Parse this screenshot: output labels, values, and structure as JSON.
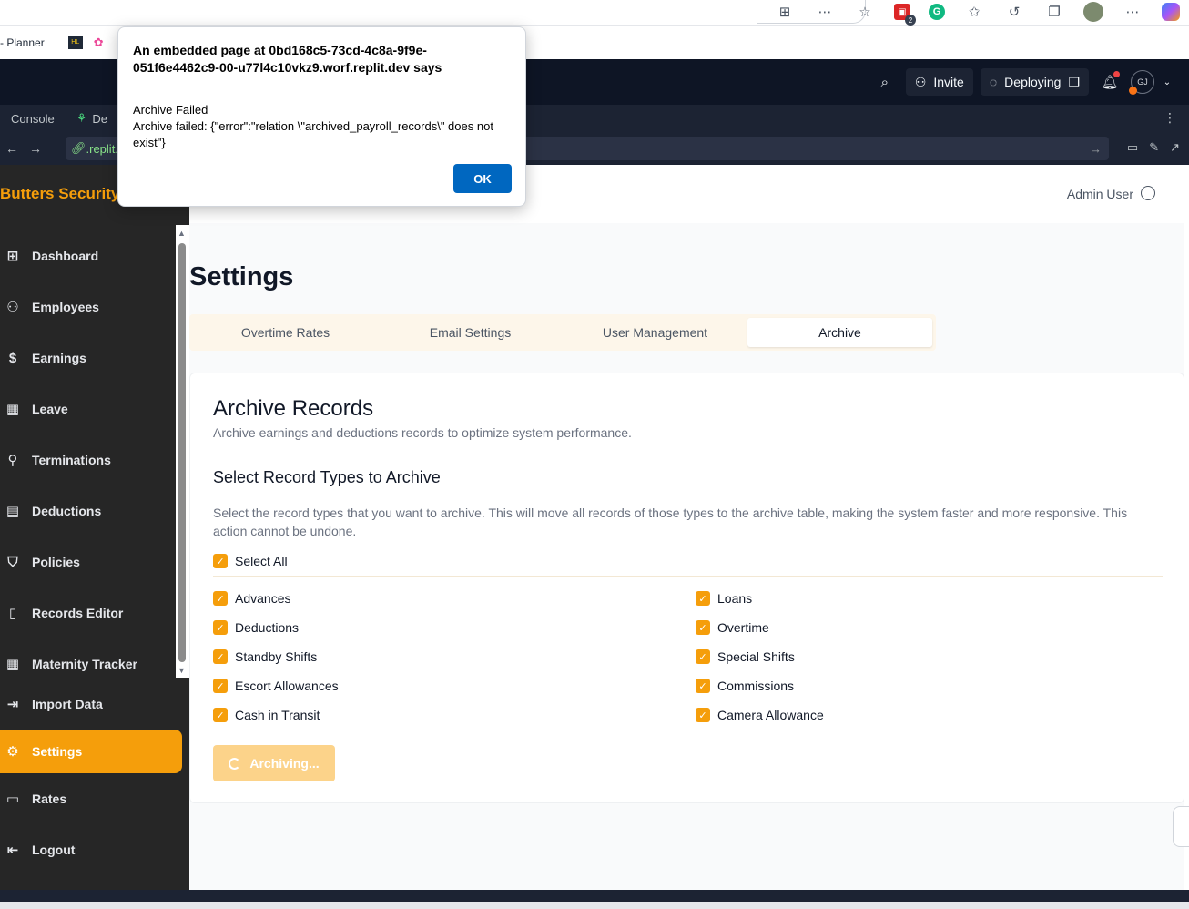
{
  "browser": {
    "bookmarks": [
      {
        "label": "- Planner"
      }
    ],
    "ext_badge": "2"
  },
  "replit": {
    "invite_label": "Invite",
    "deploying_label": "Deploying",
    "avatar_initials": "GJ",
    "tabs": [
      "Console",
      "De"
    ],
    "url_text": ".replit."
  },
  "dialog": {
    "title": "An embedded page at 0bd168c5-73cd-4c8a-9f9e-051f6e4462c9-00-u77l4c10vkz9.worf.replit.dev says",
    "line1": "Archive Failed",
    "line2": "Archive failed: {\"error\":\"relation \\\"archived_payroll_records\\\" does not exist\"}",
    "ok_label": "OK"
  },
  "app": {
    "brand": "Butters Security",
    "admin_user": "Admin User",
    "nav": [
      {
        "label": "Dashboard",
        "icon": "grid-icon"
      },
      {
        "label": "Employees",
        "icon": "users-icon"
      },
      {
        "label": "Earnings",
        "icon": "dollar-icon"
      },
      {
        "label": "Leave",
        "icon": "calendar-icon"
      },
      {
        "label": "Terminations",
        "icon": "user-minus-icon"
      },
      {
        "label": "Deductions",
        "icon": "wallet-icon"
      },
      {
        "label": "Policies",
        "icon": "shield-icon"
      },
      {
        "label": "Records Editor",
        "icon": "file-icon"
      },
      {
        "label": "Maternity Tracker",
        "icon": "calendar-icon"
      },
      {
        "label": "Import Data",
        "icon": "import-icon"
      },
      {
        "label": "Settings",
        "icon": "gear-icon",
        "active": true
      },
      {
        "label": "Rates",
        "icon": "card-icon"
      },
      {
        "label": "Logout",
        "icon": "logout-icon"
      }
    ],
    "page_title": "Settings",
    "tabs": [
      {
        "label": "Overtime Rates"
      },
      {
        "label": "Email Settings"
      },
      {
        "label": "User Management"
      },
      {
        "label": "Archive",
        "active": true
      }
    ],
    "card": {
      "title": "Archive Records",
      "description": "Archive earnings and deductions records to optimize system performance.",
      "section_title": "Select Record Types to Archive",
      "section_description": "Select the record types that you want to archive. This will move all records of those types to the archive table, making the system faster and more responsive. This action cannot be undone.",
      "select_all": "Select All",
      "left_items": [
        "Advances",
        "Deductions",
        "Standby Shifts",
        "Escort Allowances",
        "Cash in Transit"
      ],
      "right_items": [
        "Loans",
        "Overtime",
        "Special Shifts",
        "Commissions",
        "Camera Allowance"
      ],
      "archive_button": "Archiving..."
    }
  },
  "colors": {
    "accent": "#f59e0b",
    "sidebar_bg": "#262626",
    "replit_bg": "#0e1525",
    "dialog_button": "#0067c0"
  }
}
